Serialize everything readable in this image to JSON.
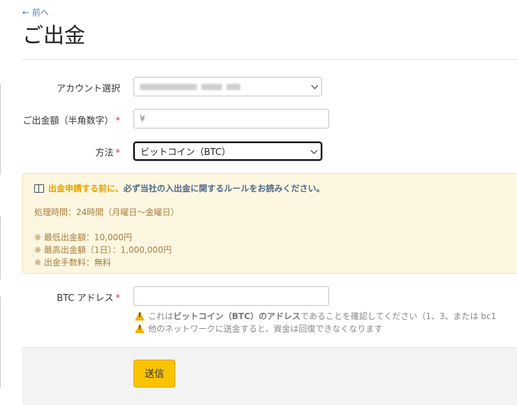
{
  "nav": {
    "back_label": "← 前へ"
  },
  "page": {
    "title": "ご出金"
  },
  "form": {
    "account": {
      "label": "アカウント選択",
      "value": ""
    },
    "amount": {
      "label": "ご出金額（半角数字）",
      "required_mark": "*",
      "placeholder": "¥"
    },
    "method": {
      "label": "方法",
      "required_mark": "*",
      "value": "ビットコイン（BTC）"
    },
    "btc_address": {
      "label": "BTC アドレス",
      "required_mark": "*",
      "placeholder": ""
    }
  },
  "notice": {
    "headline_highlight": "出金申請する前に、",
    "headline_rest": "必ず当社の入出金に関するルールをお読みください。",
    "processing_time": "処理時間：24時間（月曜日～金曜日）",
    "min_amount": "※ 最低出金額：10,000円",
    "max_amount": "※ 最高出金額（1日）：1,000,000円",
    "fee": "※ 出金手数料：無料"
  },
  "warnings": {
    "line1_pre": "これは",
    "line1_bold": "ビットコイン（BTC）のアドレス",
    "line1_post": "であることを確認してください（1、3、または bc1",
    "line2": "他のネットワークに送金すると、資金は回復できなくなります"
  },
  "submit": {
    "label": "送信"
  },
  "colors": {
    "accent": "#f9c300",
    "required": "#e03030",
    "notice_bg": "#fdf6e1",
    "notice_text": "#a8803d"
  }
}
